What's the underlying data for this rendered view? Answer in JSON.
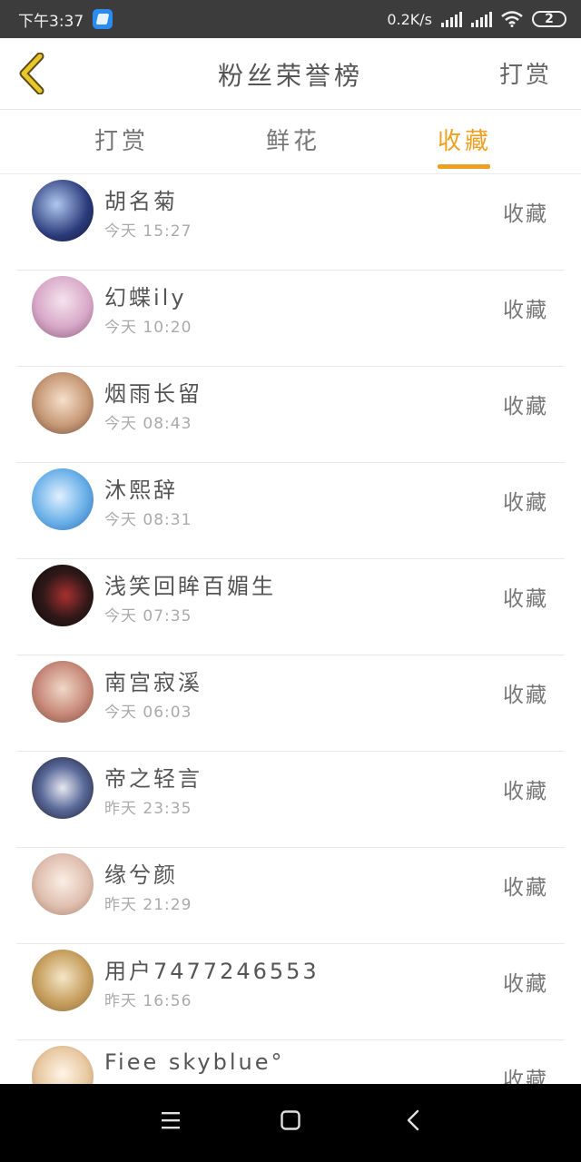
{
  "status_bar": {
    "time": "下午3:37",
    "network_speed": "0.2K/s",
    "battery": "2"
  },
  "header": {
    "title": "粉丝荣誉榜",
    "action_label": "打赏"
  },
  "tabs": [
    {
      "label": "打赏",
      "active": false
    },
    {
      "label": "鲜花",
      "active": false
    },
    {
      "label": "收藏",
      "active": true
    }
  ],
  "colors": {
    "accent": "#f0a020",
    "status_bar_bg": "#3c3c3c",
    "back_icon": "#d9b81e"
  },
  "list": [
    {
      "name": "胡名菊",
      "time": "今天 15:27",
      "action": "收藏"
    },
    {
      "name": "幻蝶ily",
      "time": "今天 10:20",
      "action": "收藏"
    },
    {
      "name": "烟雨长留",
      "time": "今天 08:43",
      "action": "收藏"
    },
    {
      "name": "沐熙辞",
      "time": "今天 08:31",
      "action": "收藏"
    },
    {
      "name": "浅笑回眸百媚生",
      "time": "今天 07:35",
      "action": "收藏"
    },
    {
      "name": "南宫寂溪",
      "time": "今天 06:03",
      "action": "收藏"
    },
    {
      "name": "帝之轻言",
      "time": "昨天 23:35",
      "action": "收藏"
    },
    {
      "name": "缘兮颜",
      "time": "昨天 21:29",
      "action": "收藏"
    },
    {
      "name": "用户7477246553",
      "time": "昨天 16:56",
      "action": "收藏"
    },
    {
      "name": "Fiee skyblue°",
      "time": "",
      "action": "收藏"
    }
  ],
  "nav": {
    "menu_icon": "menu-icon",
    "home_icon": "home-icon",
    "back_icon": "back-icon"
  }
}
